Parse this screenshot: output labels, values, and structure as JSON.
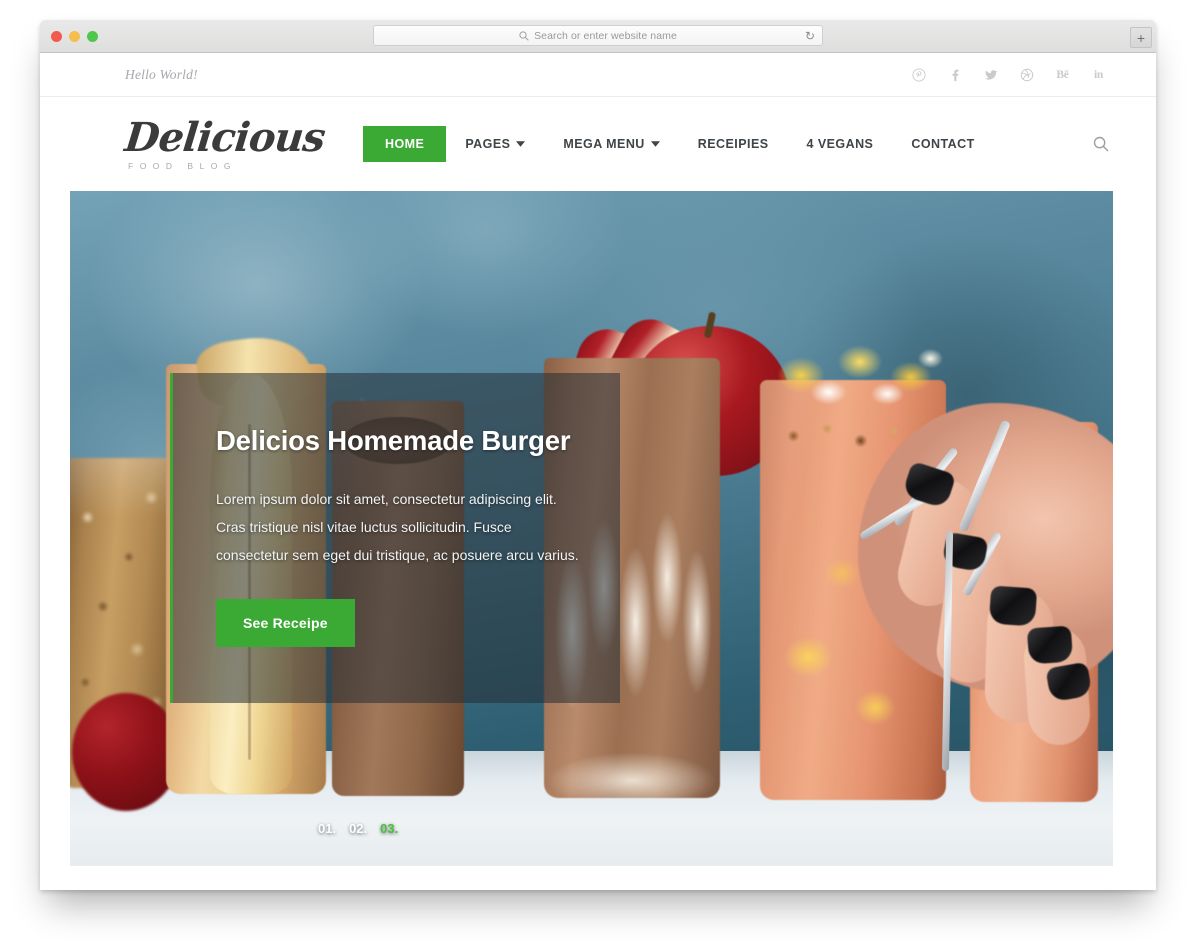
{
  "browser": {
    "traffic_lights": [
      "close",
      "minimize",
      "maximize"
    ],
    "address_placeholder": "Search or enter website name",
    "reload_icon": "reload-icon",
    "search_icon": "search-icon",
    "newtab_label": "+"
  },
  "topbar": {
    "tagline": "Hello World!",
    "socials": [
      {
        "name": "pinterest",
        "glyph": "P"
      },
      {
        "name": "facebook",
        "glyph": "f"
      },
      {
        "name": "twitter",
        "glyph": "t"
      },
      {
        "name": "dribbble",
        "glyph": "d"
      },
      {
        "name": "behance",
        "glyph": "Bē"
      },
      {
        "name": "linkedin",
        "glyph": "in"
      }
    ]
  },
  "header": {
    "logo_name": "Delicious",
    "logo_tagline": "FOOD BLOG",
    "nav": [
      {
        "label": "HOME",
        "active": true,
        "caret": false
      },
      {
        "label": "PAGES",
        "active": false,
        "caret": true
      },
      {
        "label": "MEGA MENU",
        "active": false,
        "caret": true
      },
      {
        "label": "RECEIPIES",
        "active": false,
        "caret": false
      },
      {
        "label": "4 VEGANS",
        "active": false,
        "caret": false
      },
      {
        "label": "CONTACT",
        "active": false,
        "caret": false
      }
    ],
    "search_icon": "search-icon"
  },
  "hero": {
    "title": "Delicios Homemade Burger",
    "text": "Lorem ipsum dolor sit amet, consectetur adipiscing elit. Cras tristique nisl vitae luctus sollicitudin. Fusce consectetur sem eget dui tristique, ac posuere arcu varius.",
    "cta_label": "See Receipe",
    "pagination": [
      {
        "label": "01.",
        "active": false
      },
      {
        "label": "02.",
        "active": false
      },
      {
        "label": "03.",
        "active": true
      }
    ]
  },
  "colors": {
    "brand_green": "#3aaa35",
    "active_pager_green": "#49c23f",
    "nav_text": "#3f4448",
    "tagline_gray": "#a6a8ad",
    "social_gray": "#c8cace"
  }
}
